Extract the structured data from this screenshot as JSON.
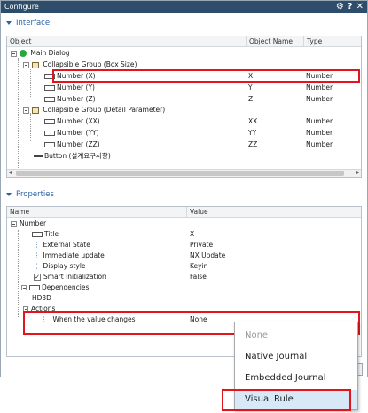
{
  "window": {
    "title": "Configure",
    "icons": [
      "gear-icon",
      "help-icon",
      "close-icon"
    ],
    "title_bar_color": "#2e4d6b"
  },
  "interface": {
    "heading": "Interface",
    "columns": [
      "Object",
      "Object Name",
      "Type"
    ],
    "rows": [
      {
        "label": "Main Dialog",
        "name": "",
        "type": ""
      },
      {
        "label": "Collapsible Group (Box Size)",
        "name": "",
        "type": ""
      },
      {
        "label": "Number (X)",
        "name": "X",
        "type": "Number"
      },
      {
        "label": "Number (Y)",
        "name": "Y",
        "type": "Number"
      },
      {
        "label": "Number (Z)",
        "name": "Z",
        "type": "Number"
      },
      {
        "label": "Collapsible Group (Detail Parameter)",
        "name": "",
        "type": ""
      },
      {
        "label": "Number (XX)",
        "name": "XX",
        "type": "Number"
      },
      {
        "label": "Number (YY)",
        "name": "YY",
        "type": "Number"
      },
      {
        "label": "Number (ZZ)",
        "name": "ZZ",
        "type": "Number"
      },
      {
        "label": "Button (설계요구사항)",
        "name": "",
        "type": ""
      }
    ]
  },
  "properties": {
    "heading": "Properties",
    "columns": [
      "Name",
      "Value"
    ],
    "rows": [
      {
        "label": "Number",
        "value": ""
      },
      {
        "label": "Title",
        "value": "X"
      },
      {
        "label": "External State",
        "value": "Private"
      },
      {
        "label": "Immediate update",
        "value": "NX Update"
      },
      {
        "label": "Display style",
        "value": "Keyin"
      },
      {
        "label": "Smart Initialization",
        "value": "False"
      },
      {
        "label": "Dependencies",
        "value": ""
      },
      {
        "label": "HD3D",
        "value": ""
      },
      {
        "label": "Actions",
        "value": ""
      },
      {
        "label": "When the value changes",
        "value": "None"
      }
    ]
  },
  "dropdown": {
    "options": [
      "None",
      "Native Journal",
      "Embedded Journal",
      "Visual Rule"
    ],
    "selected": "Visual Rule",
    "highlight_color": "#d7e8f7"
  },
  "highlight_color": "#e3141c"
}
